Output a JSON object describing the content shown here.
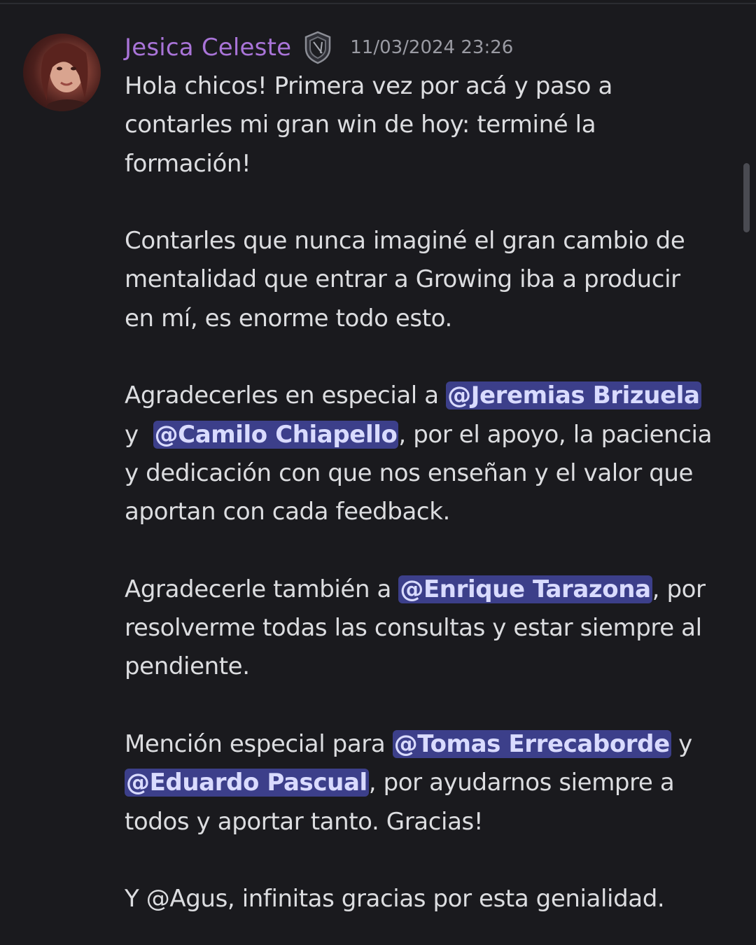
{
  "author": {
    "name": "Jesica Celeste",
    "badge_icon": "shield-badge-icon",
    "timestamp": "11/03/2024 23:26",
    "name_color": "#a974d8"
  },
  "mention_color": "#3c3f8a",
  "message": {
    "p1": {
      "line1": "Hola chicos! Primera vez por acá y paso a",
      "line2": "contarles mi gran win de hoy: terminé la",
      "line3": "formación!"
    },
    "p2": {
      "line1": "Contarles que nunca imaginé el gran cambio de",
      "line2": "mentalidad que entrar a Growing iba a producir",
      "line3": "en mí, es enorme todo esto."
    },
    "p3": {
      "line1_text": "Agradecerles en especial a ",
      "line1_mention": "@Jeremias Brizuela",
      "line2_prefix": "y ",
      "line2_mention": "@Camilo Chiapello",
      "line2_suffix": ", por el apoyo, la paciencia",
      "line3": "y dedicación con que nos enseñan y el valor que",
      "line4": "aportan con cada feedback."
    },
    "p4": {
      "line1_text": "Agradecerle también a ",
      "line1_mention": "@Enrique Tarazona",
      "line1_suffix": ", por",
      "line2": "resolverme todas las consultas y estar siempre al",
      "line3": "pendiente."
    },
    "p5": {
      "line1_text": "Mención especial para ",
      "line1_mention": "@Tomas Errecaborde",
      "line1_suffix": " y",
      "line2_mention": "@Eduardo Pascual",
      "line2_suffix": ", por ayudarnos siempre a",
      "line3": "todos y aportar tanto. Gracias!"
    },
    "p6": {
      "line1": "Y @Agus, infinitas gracias por esta genialidad."
    }
  }
}
